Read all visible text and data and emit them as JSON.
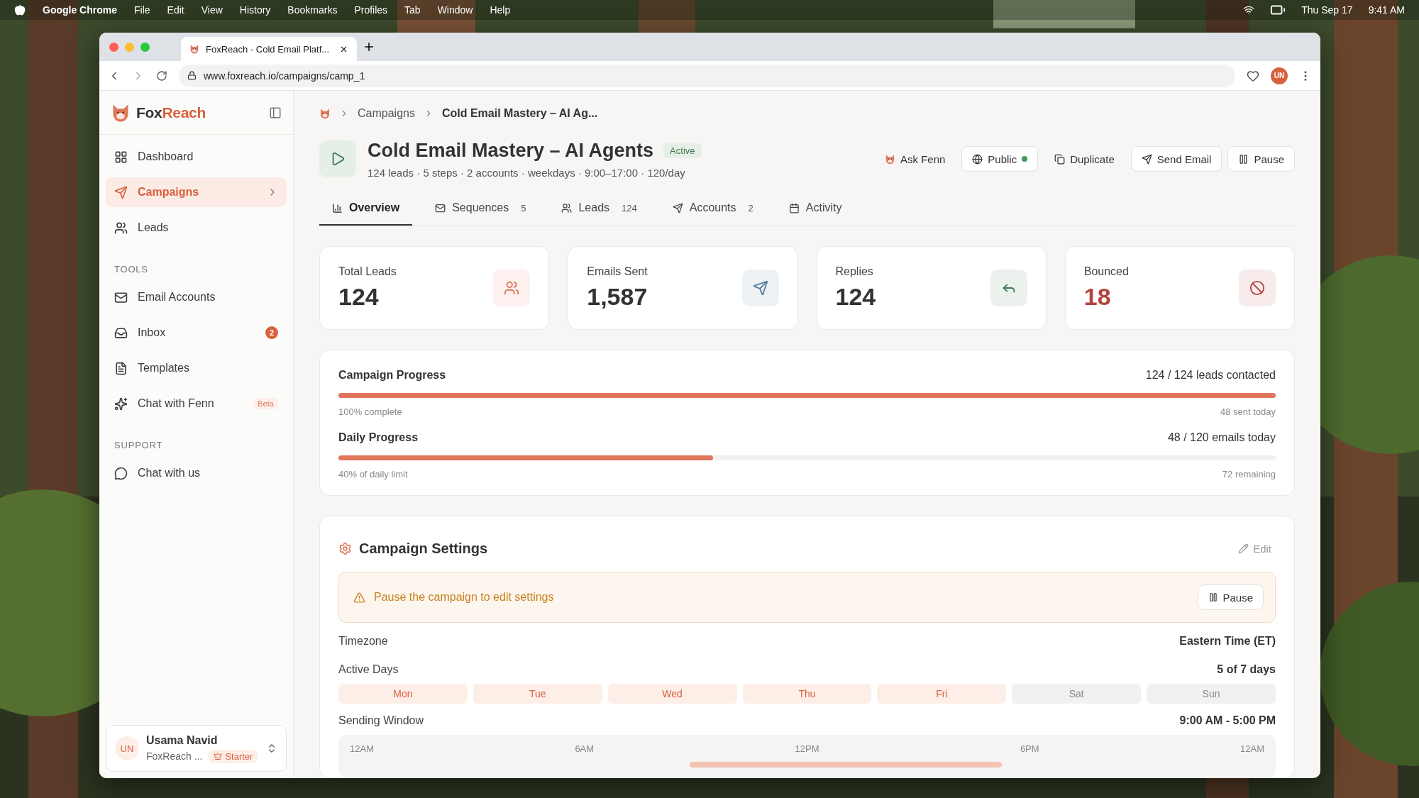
{
  "menu_bar": {
    "app": "Google Chrome",
    "menus": [
      "File",
      "Edit",
      "View",
      "History",
      "Bookmarks",
      "Profiles",
      "Tab",
      "Window",
      "Help"
    ],
    "date": "Thu Sep 17",
    "time": "9:41 AM"
  },
  "browser": {
    "tab_title": "FoxReach - Cold Email Platf...",
    "url": "www.foxreach.io/campaigns/camp_1",
    "profile": "UN"
  },
  "sidebar": {
    "brand_main": "Fox",
    "brand_accent": "Reach",
    "groups": [
      {
        "items": [
          {
            "label": "Dashboard",
            "selected": false
          },
          {
            "label": "Campaigns",
            "selected": true
          },
          {
            "label": "Leads",
            "selected": false
          }
        ]
      },
      {
        "heading": "TOOLS",
        "items": [
          {
            "label": "Email Accounts",
            "selected": false
          },
          {
            "label": "Inbox",
            "selected": false,
            "badge": "2"
          },
          {
            "label": "Templates",
            "selected": false
          },
          {
            "label": "Chat with Fenn",
            "selected": false,
            "tag": "Beta"
          }
        ]
      },
      {
        "heading": "SUPPORT",
        "items": [
          {
            "label": "Chat with us",
            "selected": false
          }
        ]
      }
    ],
    "user": {
      "initials": "UN",
      "name": "Usama Navid",
      "org": "FoxReach ...",
      "plan": "Starter"
    }
  },
  "breadcrumb": [
    "Campaigns",
    "Cold Email Mastery – AI Ag..."
  ],
  "campaign": {
    "title": "Cold Email Mastery – AI Agents",
    "status": "Active",
    "meta": "124 leads · 5 steps · 2 accounts · weekdays · 9:00–17:00 · 120/day"
  },
  "actions": [
    {
      "label": "Ask Fenn",
      "kind": "plain"
    },
    {
      "label": "Public",
      "kind": "outlined",
      "live": true
    },
    {
      "label": "Duplicate",
      "kind": "plain"
    },
    {
      "label": "Send Email",
      "kind": "outlined"
    },
    {
      "label": "Pause",
      "kind": "outlined"
    }
  ],
  "tabs": [
    {
      "label": "Overview",
      "selected": true
    },
    {
      "label": "Sequences",
      "count": "5",
      "selected": false
    },
    {
      "label": "Leads",
      "count": "124",
      "selected": false
    },
    {
      "label": "Accounts",
      "count": "2",
      "selected": false
    },
    {
      "label": "Activity",
      "selected": false
    }
  ],
  "stats": [
    {
      "label": "Total Leads",
      "value": "124",
      "color": "#e0775b",
      "alert": false
    },
    {
      "label": "Emails Sent",
      "value": "1,587",
      "color": "#5b7f9b",
      "alert": false
    },
    {
      "label": "Replies",
      "value": "124",
      "color": "#3f7a52",
      "alert": false
    },
    {
      "label": "Bounced",
      "value": "18",
      "color": "#b5443c",
      "alert": true
    }
  ],
  "progress": [
    {
      "title": "Campaign Progress",
      "reading": "124 / 124 leads contacted",
      "level": 1,
      "note": "100% complete",
      "note_right": "48 sent today"
    },
    {
      "title": "Daily Progress",
      "reading": "48 / 120 emails today",
      "level": 0.4,
      "note": "40% of daily limit",
      "note_right": "72 remaining"
    }
  ],
  "settings": {
    "title": "Campaign Settings",
    "edit": "Edit",
    "notice": "Pause the campaign to edit settings",
    "notice_button": "Pause",
    "timezone": {
      "label": "Timezone",
      "value": "Eastern Time (ET)"
    },
    "active_days": {
      "label": "Active Days",
      "value": "5 of 7 days"
    },
    "days": [
      {
        "label": "Mon",
        "selected": true
      },
      {
        "label": "Tue",
        "selected": true
      },
      {
        "label": "Wed",
        "selected": true
      },
      {
        "label": "Thu",
        "selected": true
      },
      {
        "label": "Fri",
        "selected": true
      },
      {
        "label": "Sat",
        "selected": false
      },
      {
        "label": "Sun",
        "selected": false
      }
    ],
    "sending_window": {
      "label": "Sending Window",
      "value": "9:00 AM - 5:00 PM"
    },
    "timeline_ticks": [
      "12AM",
      "6AM",
      "12PM",
      "6PM",
      "12AM"
    ]
  }
}
